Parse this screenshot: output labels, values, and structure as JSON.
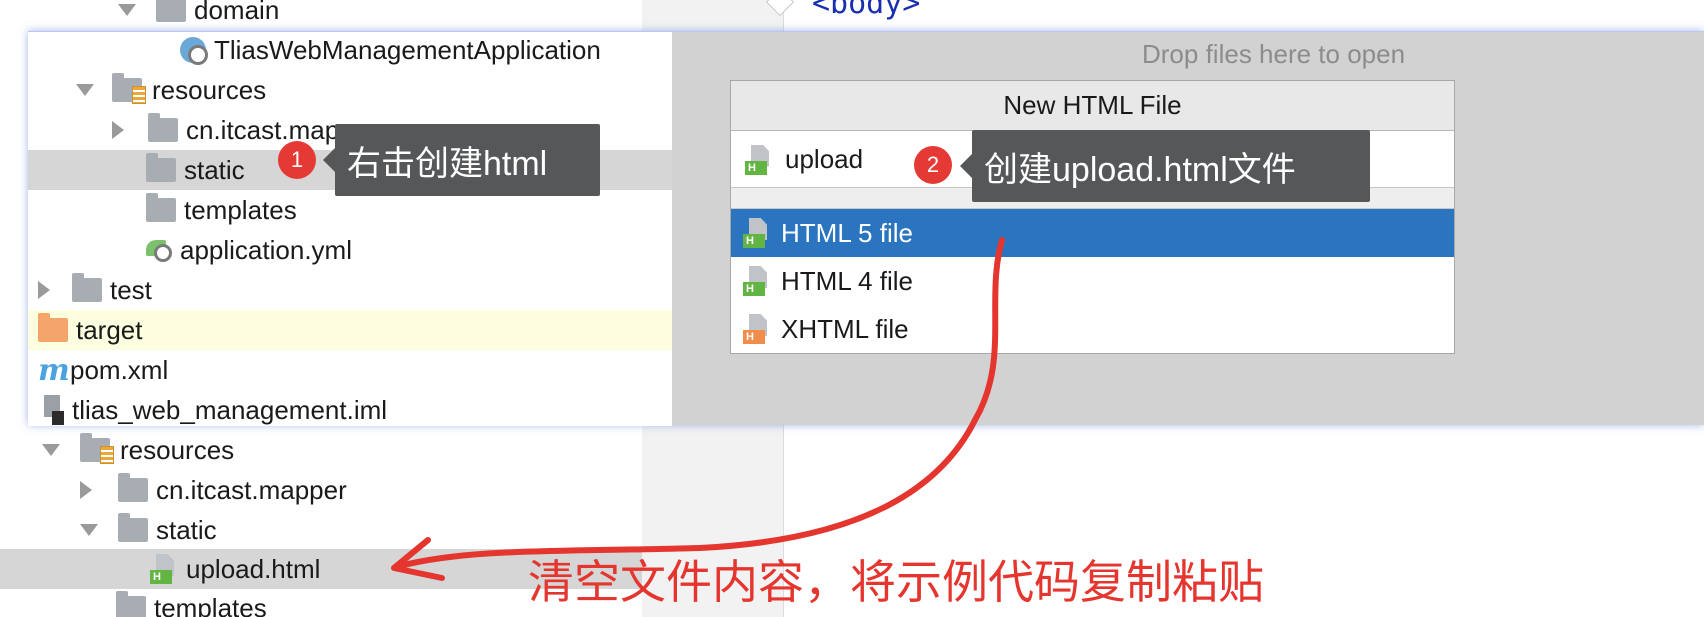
{
  "background_tree": {
    "top_item": "domain",
    "items": [
      {
        "label": "resources",
        "kind": "resources-folder",
        "expanded": true
      },
      {
        "label": "cn.itcast.mapper",
        "kind": "folder",
        "expanded": false
      },
      {
        "label": "static",
        "kind": "folder",
        "expanded": true
      },
      {
        "label": "upload.html",
        "kind": "html-file",
        "selected": true
      },
      {
        "label": "templates",
        "kind": "folder"
      }
    ]
  },
  "background_editor": {
    "code_fragment": "<body>"
  },
  "popup": {
    "drop_hint": "Drop files here to open",
    "tree": [
      {
        "label": "TliasWebManagementApplication",
        "kind": "spring-class"
      },
      {
        "label": "resources",
        "kind": "resources-folder",
        "expanded": true
      },
      {
        "label": "cn.itcast.mapper",
        "kind": "folder",
        "expanded": false
      },
      {
        "label": "static",
        "kind": "folder",
        "selected": true
      },
      {
        "label": "templates",
        "kind": "folder"
      },
      {
        "label": "application.yml",
        "kind": "yml-file"
      },
      {
        "label": "test",
        "kind": "folder",
        "expanded": false
      },
      {
        "label": "target",
        "kind": "target-folder",
        "highlighted": true
      },
      {
        "label": "pom.xml",
        "kind": "maven-file"
      },
      {
        "label": "tlias_web_management.iml",
        "kind": "iml-file"
      }
    ]
  },
  "dialog": {
    "title": "New HTML File",
    "input_value": "upload",
    "options": [
      {
        "label": "HTML 5 file",
        "selected": true
      },
      {
        "label": "HTML 4 file",
        "selected": false
      },
      {
        "label": "XHTML file",
        "selected": false
      }
    ]
  },
  "annotations": {
    "step1": {
      "number": "1",
      "text": "右击创建html"
    },
    "step2": {
      "number": "2",
      "text": "创建upload.html文件"
    },
    "instruction": "清空文件内容，将示例代码复制粘贴"
  },
  "colors": {
    "selection_blue": "#2a74c0",
    "annotation_red": "#e53935",
    "callout_gray": "#555759",
    "target_highlight": "#fdfde0"
  },
  "icons": {
    "html_file": "html-file-icon",
    "xhtml_file": "xhtml-file-icon",
    "folder": "folder-icon",
    "maven": "maven-icon",
    "iml": "iml-file-icon",
    "yml": "spring-yml-icon",
    "spring_class": "spring-boot-class-icon"
  }
}
